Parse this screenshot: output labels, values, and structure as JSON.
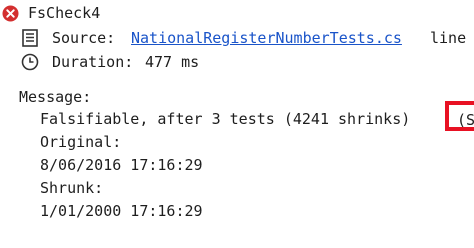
{
  "header": {
    "test_name": "FsCheck4",
    "status": "failed"
  },
  "details": {
    "source_label": "Source:",
    "source_file": "NationalRegisterNumberTests.cs",
    "source_suffix": "line",
    "duration_label": "Duration:",
    "duration_value": "477 ms"
  },
  "message": {
    "label": "Message:",
    "lines": [
      "Falsifiable, after 3 tests (4241 shrinks)",
      "Original:",
      "8/06/2016 17:16:29",
      "Shrunk:",
      "1/01/2000 17:16:29"
    ],
    "highlight_text": "(St"
  },
  "colors": {
    "error": "#d32f2f",
    "link": "#1a54c9",
    "highlight": "#e81123"
  },
  "icons": {
    "status": "error-x-icon",
    "source": "document-icon",
    "duration": "clock-icon"
  }
}
